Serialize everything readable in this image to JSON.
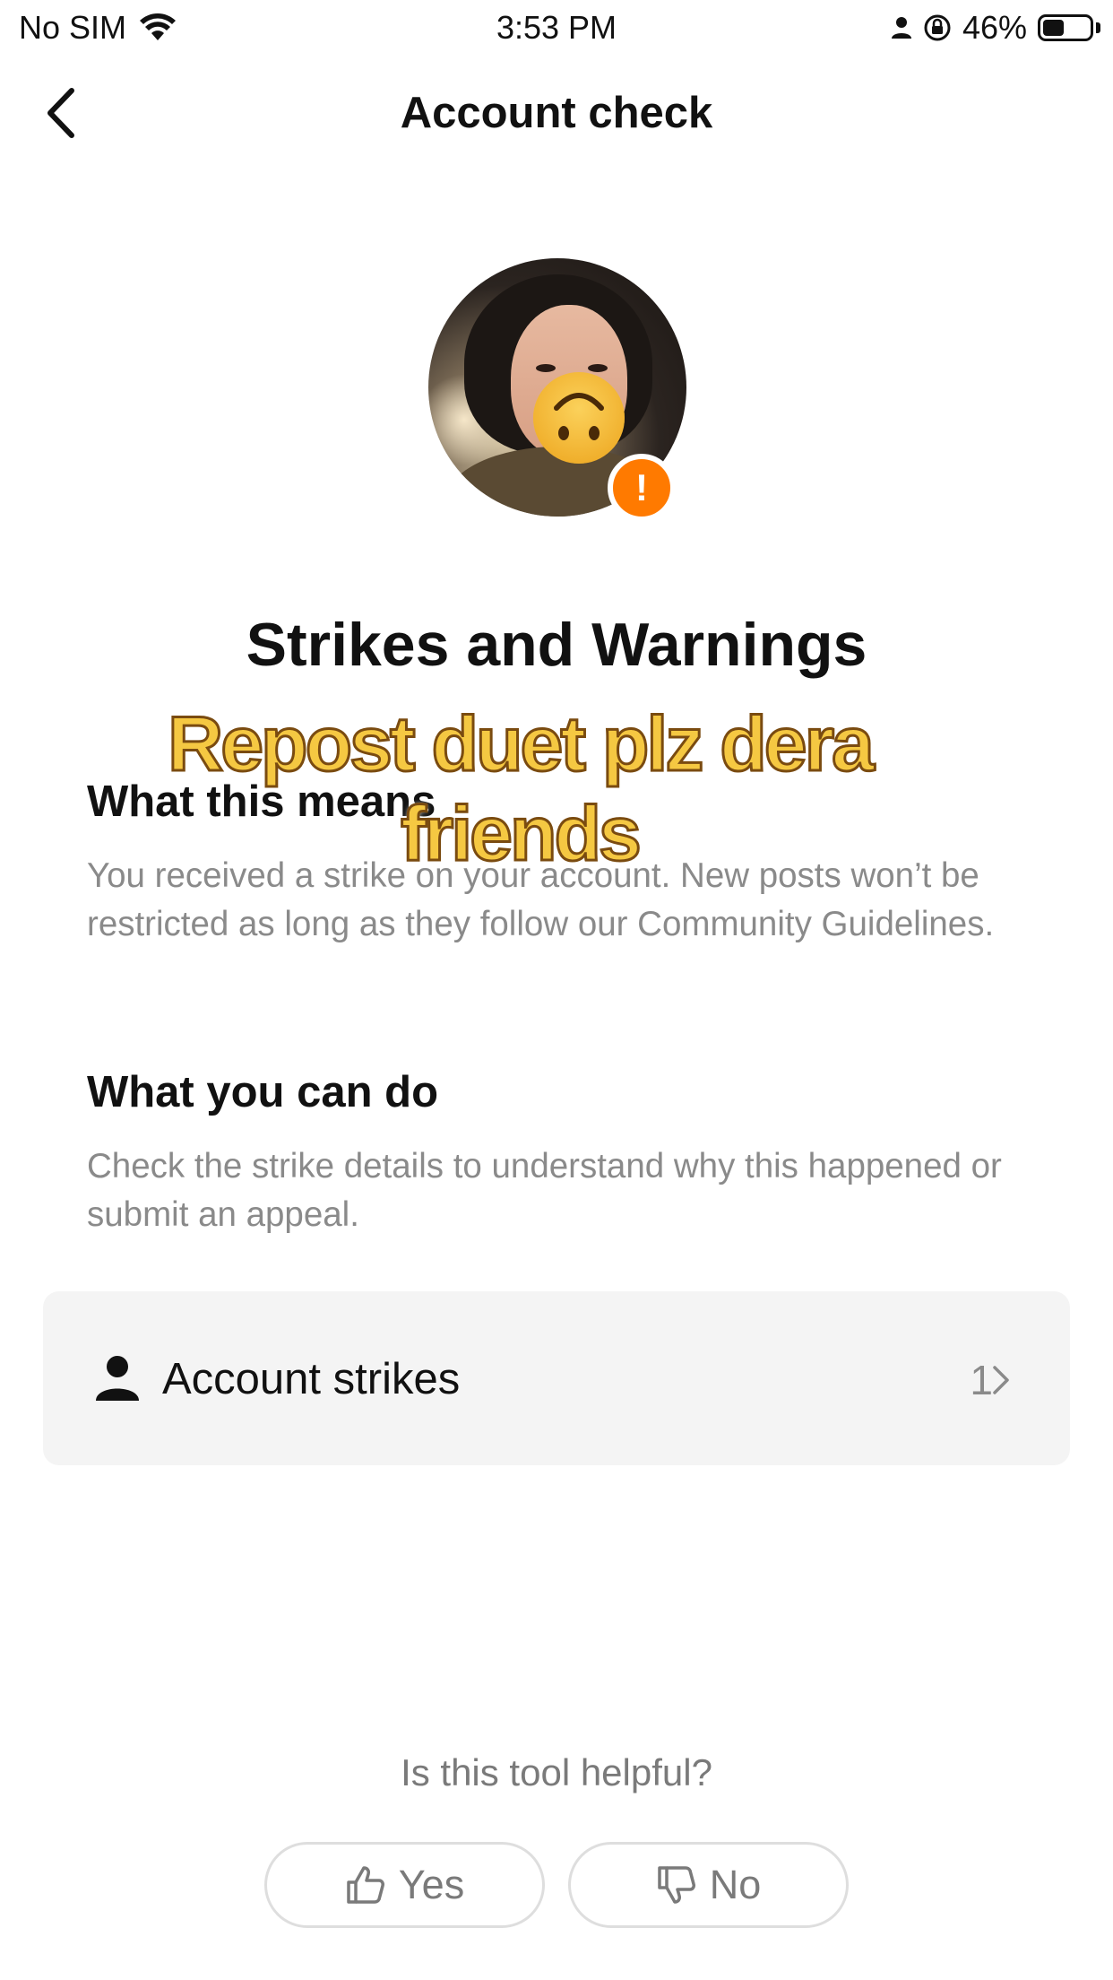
{
  "status_bar": {
    "carrier": "No SIM",
    "time": "3:53 PM",
    "battery_percent": "46%",
    "battery_level": 0.46
  },
  "nav": {
    "title": "Account check",
    "back_icon": "chevron-left-icon"
  },
  "avatar": {
    "badge_symbol": "!",
    "badge_color": "#ff7a00"
  },
  "main": {
    "heading": "Strikes and Warnings",
    "overlay_caption": "Repost duet plz dera friends",
    "sections": [
      {
        "title": "What this means",
        "body": "You received a strike on your account. New posts won’t be restricted as long as they follow our Community Guidelines."
      },
      {
        "title": "What you can do",
        "body": "Check the strike details to understand why this happened or submit an appeal."
      }
    ]
  },
  "strikes_card": {
    "label": "Account strikes",
    "count": "1",
    "icon": "person-icon"
  },
  "feedback": {
    "question": "Is this tool helpful?",
    "yes_label": "Yes",
    "no_label": "No"
  }
}
